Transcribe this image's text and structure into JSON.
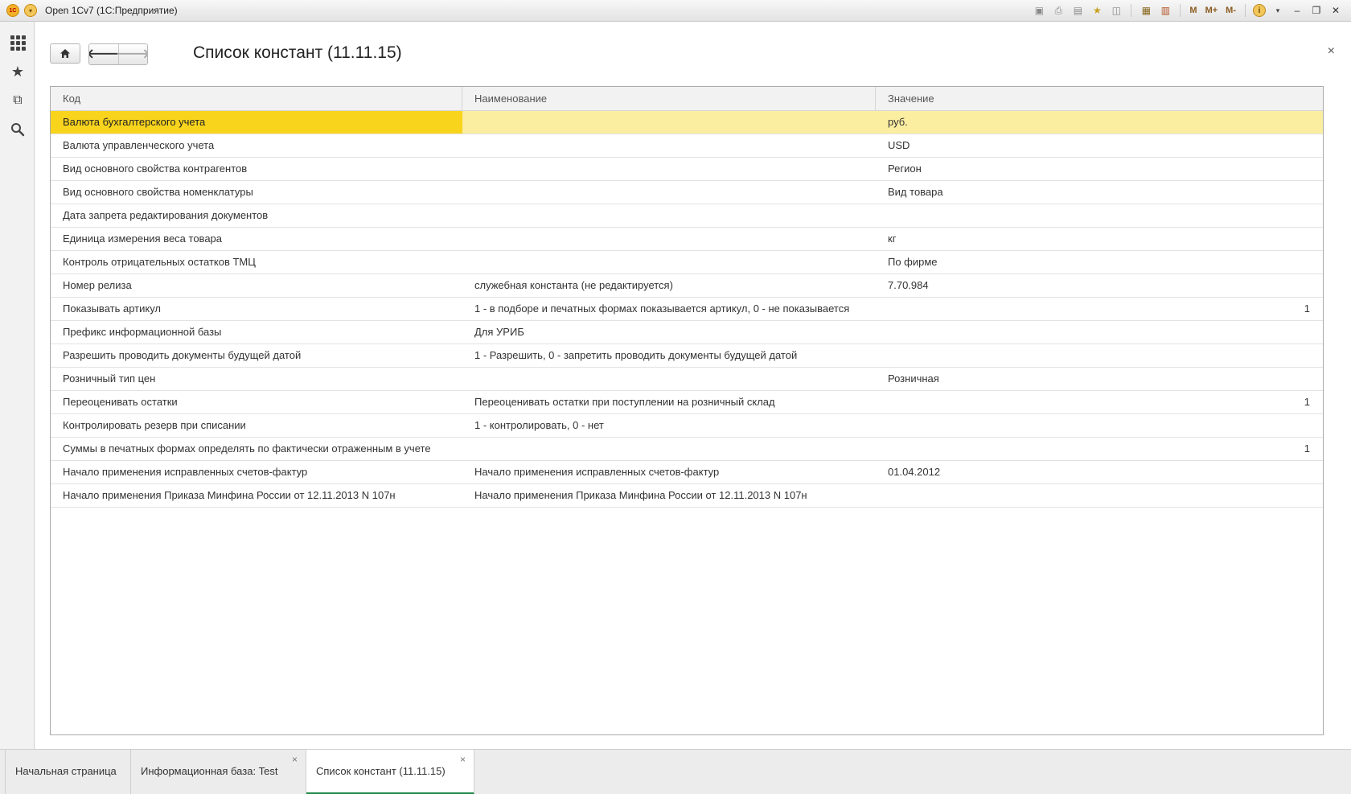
{
  "window": {
    "title": "Open 1Cv7  (1С:Предприятие)",
    "tools_text": [
      "M",
      "M+",
      "M-"
    ]
  },
  "form": {
    "title": "Список констант (11.11.15)",
    "close_symbol": "×"
  },
  "table": {
    "columns": [
      "Код",
      "Наименование",
      "Значение"
    ],
    "rows": [
      {
        "code": "Валюта бухгалтерского учета",
        "name": "",
        "value": "руб.",
        "extra": ""
      },
      {
        "code": "Валюта управленческого учета",
        "name": "",
        "value": "USD",
        "extra": ""
      },
      {
        "code": "Вид основного свойства контрагентов",
        "name": "",
        "value": "Регион",
        "extra": ""
      },
      {
        "code": "Вид основного свойства номенклатуры",
        "name": "",
        "value": "Вид товара",
        "extra": ""
      },
      {
        "code": "Дата запрета редактирования документов",
        "name": "",
        "value": "",
        "extra": ""
      },
      {
        "code": "Единица измерения веса товара",
        "name": "",
        "value": "кг",
        "extra": ""
      },
      {
        "code": "Контроль отрицательных остатков ТМЦ",
        "name": "",
        "value": "По фирме",
        "extra": ""
      },
      {
        "code": "Номер релиза",
        "name": "служебная константа (не редактируется)",
        "value": "7.70.984",
        "extra": ""
      },
      {
        "code": "Показывать артикул",
        "name": "1 - в  подборе и печатных формах показывается артикул, 0 - не показывается",
        "value": "",
        "extra": "1"
      },
      {
        "code": "Префикс информационной базы",
        "name": "Для УРИБ",
        "value": "",
        "extra": ""
      },
      {
        "code": "Разрешить проводить документы будущей датой",
        "name": "1 - Разрешить, 0 - запретить проводить документы будущей датой",
        "value": "",
        "extra": ""
      },
      {
        "code": "Розничный тип цен",
        "name": "",
        "value": "Розничная",
        "extra": ""
      },
      {
        "code": "Переоценивать остатки",
        "name": "Переоценивать остатки при поступлении на розничный склад",
        "value": "",
        "extra": "1"
      },
      {
        "code": "Контролировать резерв при списании",
        "name": "1 - контролировать, 0 - нет",
        "value": "",
        "extra": ""
      },
      {
        "code": "Суммы в печатных формах определять по фактически отраженным в учете",
        "name": "",
        "value": "",
        "extra": "1"
      },
      {
        "code": "Начало применения исправленных счетов-фактур",
        "name": "Начало применения исправленных счетов-фактур",
        "value": "01.04.2012",
        "extra": ""
      },
      {
        "code": "Начало применения Приказа Минфина России от 12.11.2013 N 107н",
        "name": "Начало применения Приказа Минфина России от 12.11.2013 N 107н",
        "value": "",
        "extra": ""
      }
    ],
    "selected_row": 0
  },
  "tabs": [
    {
      "label": "Начальная страница",
      "closable": false,
      "active": false
    },
    {
      "label": "Информационная база: Test",
      "closable": true,
      "active": false
    },
    {
      "label": "Список констант (11.11.15)",
      "closable": true,
      "active": true
    }
  ],
  "colors": {
    "selected_cell": "#f9d41d",
    "selected_row": "#fbeea1",
    "active_tab_underline": "#1e8a46"
  }
}
